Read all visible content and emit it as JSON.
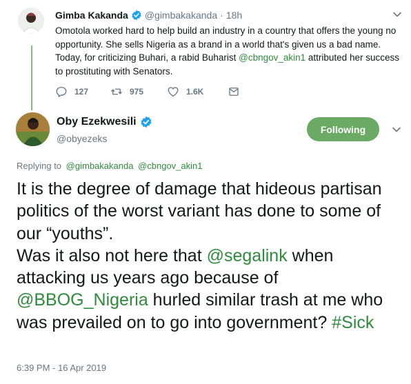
{
  "parent_tweet": {
    "display_name": "Gimba Kakanda",
    "handle": "@gimbakakanda",
    "separator": "·",
    "age": "18h",
    "text_segments": [
      {
        "text": "Omotola worked hard to help build an industry in a country that offers the young no opportunity. She sells Nigeria as a brand in a world that's given us a bad name. Today, for criticizing Buhari, a rabid Buharist ",
        "mention": false
      },
      {
        "text": "@cbngov_akin1",
        "mention": true
      },
      {
        "text": " attributed her success to prostituting with Senators.",
        "mention": false
      }
    ],
    "reply_count": "127",
    "retweet_count": "975",
    "like_count": "1.6K"
  },
  "main_tweet": {
    "display_name": "Oby Ezekwesili",
    "handle": "@obyezeks",
    "follow_label": "Following",
    "replying_label": "Replying to",
    "replying_to": [
      "@gimbakakanda",
      "@cbngov_akin1"
    ],
    "text_segments": [
      {
        "text": "It is the degree of damage that hideous partisan politics of the worst variant has done to some of our “youths”.",
        "mention": false,
        "break_after": true
      },
      {
        "text": "Was it also not here that ",
        "mention": false
      },
      {
        "text": "@segalink",
        "mention": true
      },
      {
        "text": " when attacking us years ago because of ",
        "mention": false
      },
      {
        "text": "@BBOG_Nigeria",
        "mention": true
      },
      {
        "text": " hurled similar trash at me who was prevailed on to go into government? ",
        "mention": false
      },
      {
        "text": "#Sick",
        "mention": true
      }
    ],
    "timestamp": "6:39 PM - 16 Apr 2019"
  },
  "icons": {
    "verified": "verified-badge-icon",
    "chevron": "chevron-down-icon",
    "reply": "reply-icon",
    "retweet": "retweet-icon",
    "like": "heart-icon",
    "dm": "envelope-icon"
  },
  "colors": {
    "accent": "#2e8b3c",
    "follow_bg": "#6aaa64",
    "verified": "#1da1f2",
    "muted": "#657786",
    "thread_line": "#7fbf7f"
  }
}
